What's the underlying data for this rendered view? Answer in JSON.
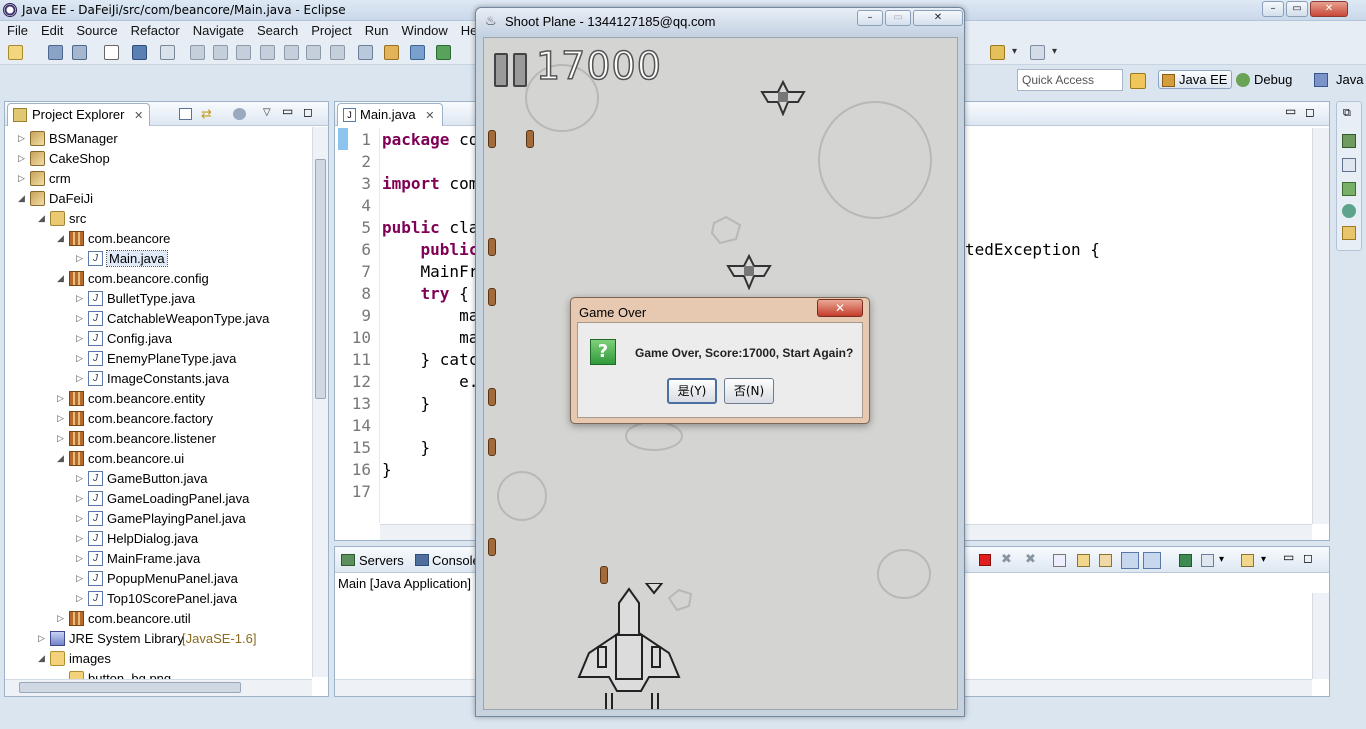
{
  "eclipse": {
    "title": "Java EE - DaFeiJi/src/com/beancore/Main.java - Eclipse",
    "menu": [
      "File",
      "Edit",
      "Source",
      "Refactor",
      "Navigate",
      "Search",
      "Project",
      "Run",
      "Window",
      "He"
    ],
    "quick_access": "Quick Access",
    "perspectives": [
      "Java EE",
      "Debug",
      "Java"
    ]
  },
  "explorer": {
    "tab_label": "Project Explorer",
    "items": [
      {
        "label": "BSManager",
        "type": "project",
        "depth": 0,
        "twisty": "▷"
      },
      {
        "label": "CakeShop",
        "type": "project",
        "depth": 0,
        "twisty": "▷"
      },
      {
        "label": "crm",
        "type": "project",
        "depth": 0,
        "twisty": "▷"
      },
      {
        "label": "DaFeiJi",
        "type": "project",
        "depth": 0,
        "twisty": "◢"
      },
      {
        "label": "src",
        "type": "src",
        "depth": 1,
        "twisty": "◢"
      },
      {
        "label": "com.beancore",
        "type": "package",
        "depth": 2,
        "twisty": "◢"
      },
      {
        "label": "Main.java",
        "type": "java",
        "depth": 3,
        "twisty": "▷",
        "selected": true
      },
      {
        "label": "com.beancore.config",
        "type": "package",
        "depth": 2,
        "twisty": "◢"
      },
      {
        "label": "BulletType.java",
        "type": "java",
        "depth": 3,
        "twisty": "▷"
      },
      {
        "label": "CatchableWeaponType.java",
        "type": "java",
        "depth": 3,
        "twisty": "▷"
      },
      {
        "label": "Config.java",
        "type": "java",
        "depth": 3,
        "twisty": "▷"
      },
      {
        "label": "EnemyPlaneType.java",
        "type": "java",
        "depth": 3,
        "twisty": "▷"
      },
      {
        "label": "ImageConstants.java",
        "type": "java",
        "depth": 3,
        "twisty": "▷"
      },
      {
        "label": "com.beancore.entity",
        "type": "package",
        "depth": 2,
        "twisty": "▷"
      },
      {
        "label": "com.beancore.factory",
        "type": "package",
        "depth": 2,
        "twisty": "▷"
      },
      {
        "label": "com.beancore.listener",
        "type": "package",
        "depth": 2,
        "twisty": "▷"
      },
      {
        "label": "com.beancore.ui",
        "type": "package",
        "depth": 2,
        "twisty": "◢"
      },
      {
        "label": "GameButton.java",
        "type": "java",
        "depth": 3,
        "twisty": "▷"
      },
      {
        "label": "GameLoadingPanel.java",
        "type": "java",
        "depth": 3,
        "twisty": "▷"
      },
      {
        "label": "GamePlayingPanel.java",
        "type": "java",
        "depth": 3,
        "twisty": "▷"
      },
      {
        "label": "HelpDialog.java",
        "type": "java",
        "depth": 3,
        "twisty": "▷"
      },
      {
        "label": "MainFrame.java",
        "type": "java",
        "depth": 3,
        "twisty": "▷"
      },
      {
        "label": "PopupMenuPanel.java",
        "type": "java",
        "depth": 3,
        "twisty": "▷"
      },
      {
        "label": "Top10ScorePanel.java",
        "type": "java",
        "depth": 3,
        "twisty": "▷"
      },
      {
        "label": "com.beancore.util",
        "type": "package",
        "depth": 2,
        "twisty": "▷"
      },
      {
        "label": "JRE System Library",
        "suffix": "[JavaSE-1.6]",
        "type": "lib",
        "depth": 1,
        "twisty": "▷"
      },
      {
        "label": "images",
        "type": "folder",
        "depth": 1,
        "twisty": "◢"
      },
      {
        "label": "button_bg.png",
        "type": "file",
        "depth": 2,
        "twisty": ""
      }
    ]
  },
  "editor": {
    "tab_label": "Main.java",
    "line_numbers": [
      "1",
      "2",
      "3",
      "4",
      "5",
      "6",
      "7",
      "8",
      "9",
      "10",
      "11",
      "12",
      "13",
      "14",
      "15",
      "16",
      "17"
    ],
    "lines": [
      {
        "kw": "package",
        "text": " co"
      },
      {
        "kw": "",
        "text": ""
      },
      {
        "kw": "import",
        "text": " com"
      },
      {
        "kw": "",
        "text": ""
      },
      {
        "kw": "public",
        "text": " cla"
      },
      {
        "kw": "    public",
        "text": ""
      },
      {
        "kw": "",
        "text": "    MainFr"
      },
      {
        "kw": "    try",
        "text": " {"
      },
      {
        "kw": "",
        "text": "        ma"
      },
      {
        "kw": "",
        "text": "        ma"
      },
      {
        "kw": "",
        "text": "    } catc"
      },
      {
        "kw": "",
        "text": "        e."
      },
      {
        "kw": "",
        "text": "    }"
      },
      {
        "kw": "",
        "text": ""
      },
      {
        "kw": "",
        "text": "    }"
      },
      {
        "kw": "",
        "text": "}"
      },
      {
        "kw": "",
        "text": ""
      }
    ],
    "right_fragment": "tedException {"
  },
  "console": {
    "tabs": [
      "Servers",
      "Console"
    ],
    "header": "Main [Java Application]"
  },
  "game": {
    "title": "Shoot Plane - 1344127185@qq.com",
    "score": "17000"
  },
  "dialog": {
    "title": "Game Over",
    "message": "Game Over, Score:17000, Start Again?",
    "yes_label": "是(Y)",
    "no_label": "否(N)"
  }
}
